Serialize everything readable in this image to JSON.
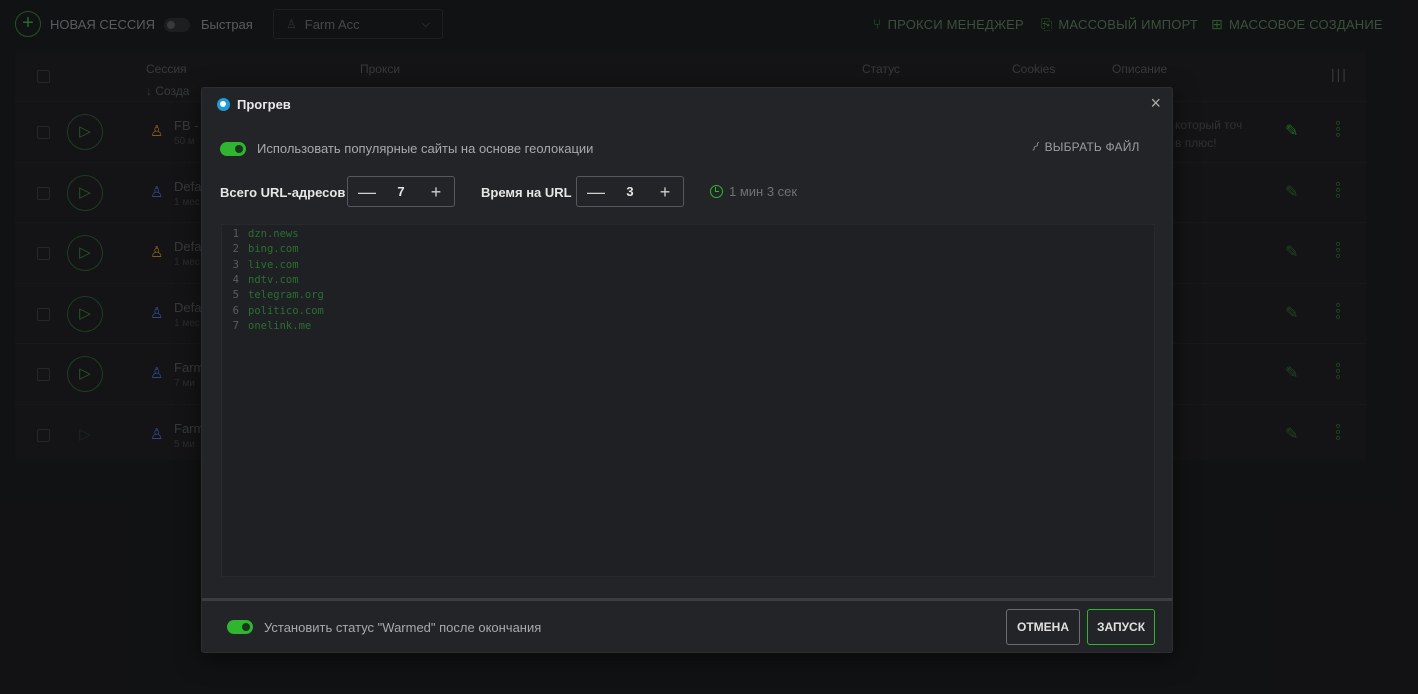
{
  "topbar": {
    "new_session": "НОВАЯ СЕССИЯ",
    "fast_label": "Быстрая",
    "farm_select": "Farm Acc",
    "proxy_manager": "ПРОКСИ МЕНЕДЖЕР",
    "mass_import": "МАССОВЫЙ ИМПОРТ",
    "mass_create": "МАССОВОЕ СОЗДАНИЕ"
  },
  "table": {
    "headers": {
      "session": "Сессия",
      "proxy": "Прокси",
      "status": "Статус",
      "cookies": "Cookies",
      "description": "Описание",
      "sort": "Созда"
    },
    "rows": [
      {
        "name": "FB -",
        "sub": "50 м",
        "person_color": "#c98a2a",
        "desc1": "который точ",
        "desc2": "в плюс!",
        "pinned": true
      },
      {
        "name": "Defa",
        "sub": "1 мес",
        "person_color": "#4a6ccf",
        "desc1": "",
        "desc2": "",
        "pinned": false
      },
      {
        "name": "Defa",
        "sub": "1 мес",
        "person_color": "#c98a2a",
        "desc1": "",
        "desc2": "",
        "pinned": false
      },
      {
        "name": "Defa",
        "sub": "1 мес",
        "person_color": "#4a6ccf",
        "desc1": "",
        "desc2": "",
        "pinned": false
      },
      {
        "name": "Farm",
        "sub": "7 ми",
        "person_color": "#4a6ccf",
        "desc1": "",
        "desc2": "",
        "pinned": false
      },
      {
        "name": "Farm",
        "sub": "5 ми",
        "person_color": "#4a6ccf",
        "desc1": "",
        "desc2": "",
        "pinned": false
      }
    ]
  },
  "modal": {
    "title": "Прогрев",
    "close_icon": "×",
    "use_popular_label": "Использовать популярные сайты на основе геолокации",
    "choose_file": "ВЫБРАТЬ ФАЙЛ",
    "total_urls_label": "Всего URL-адресов",
    "total_urls_value": "7",
    "time_per_url_label": "Время на URL",
    "time_per_url_value": "3",
    "duration": "1 мин 3 сек",
    "urls": [
      "dzn.news",
      "bing.com",
      "live.com",
      "ndtv.com",
      "telegram.org",
      "politico.com",
      "onelink.me"
    ],
    "set_status_label": "Установить статус \"Warmed\" после окончания",
    "cancel_button": "ОТМЕНА",
    "start_button": "ЗАПУСК"
  },
  "colors": {
    "accent_green": "#2fb52f",
    "background": "#1b1c1e",
    "modal_bg": "#232427"
  }
}
